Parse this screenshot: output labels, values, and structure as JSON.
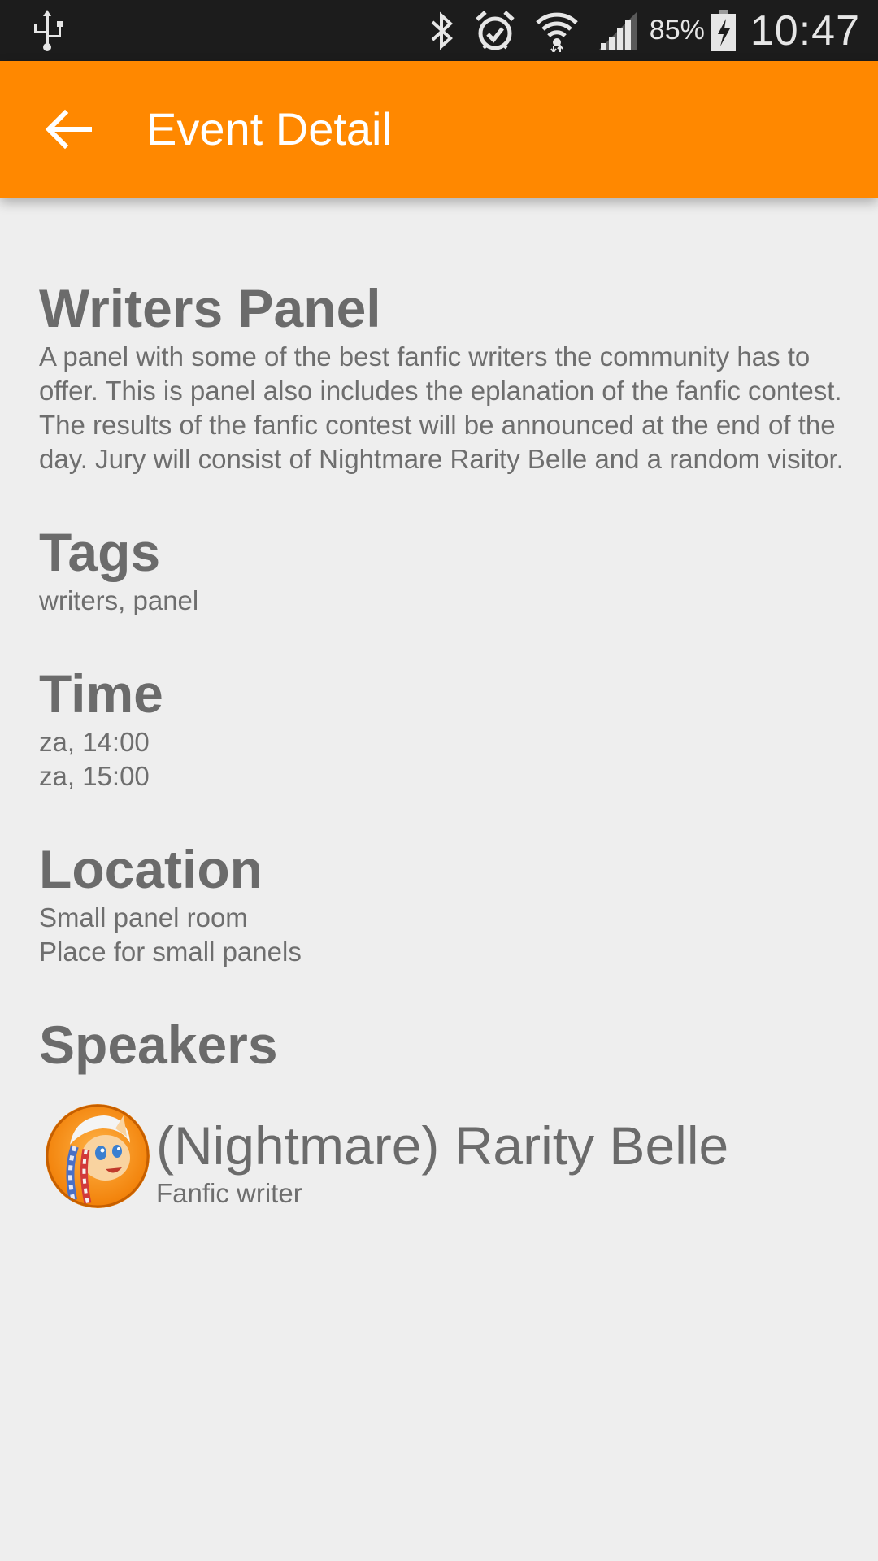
{
  "status_bar": {
    "battery_percent": "85%",
    "time": "10:47",
    "icons": [
      "usb-icon",
      "bluetooth-icon",
      "alarm-icon",
      "wifi-icon",
      "signal-icon",
      "battery-charging-icon"
    ]
  },
  "app_bar": {
    "title": "Event Detail",
    "color": "#ff8800"
  },
  "event": {
    "title": "Writers Panel",
    "description": "A panel with some of the best fanfic writers the community has to offer. This is panel also includes the eplanation of the fanfic contest. The results of the fanfic contest will be announced at the end of the day. Jury will consist of Nightmare Rarity Belle and a random visitor.",
    "tags_heading": "Tags",
    "tags": "writers, panel",
    "time_heading": "Time",
    "time_start": "za, 14:00",
    "time_end": "za, 15:00",
    "location_heading": "Location",
    "location_name": "Small panel room",
    "location_description": "Place for small panels",
    "speakers_heading": "Speakers",
    "speakers": [
      {
        "name": "(Nightmare) Rarity Belle",
        "role": "Fanfic writer"
      }
    ]
  }
}
